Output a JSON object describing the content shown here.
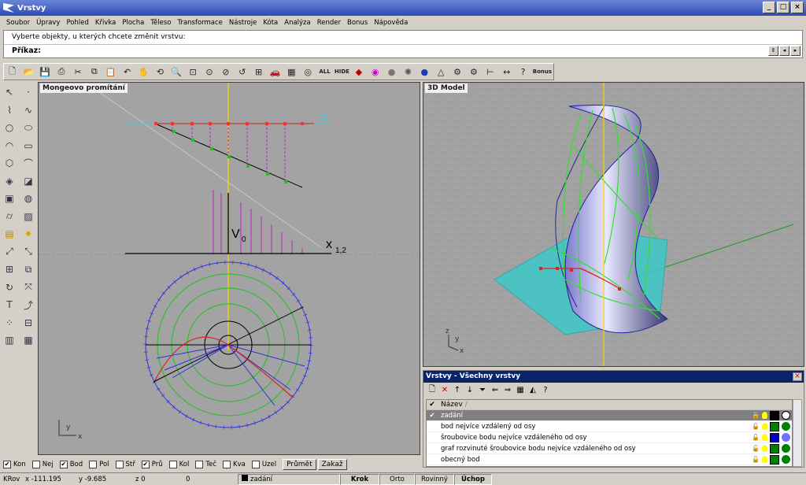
{
  "window": {
    "title": "Vrstvy"
  },
  "menu": [
    "Soubor",
    "Úpravy",
    "Pohled",
    "Křivka",
    "Plocha",
    "Těleso",
    "Transformace",
    "Nástroje",
    "Kóta",
    "Analýza",
    "Render",
    "Bonus",
    "Nápověda"
  ],
  "command": {
    "history": "Vyberte objekty, u kterých chcete změnit vrstvu:",
    "label": "Příkaz:",
    "value": ""
  },
  "toolbar": {
    "all_label": "ALL",
    "hide_label": "HIDE",
    "bonus_label": "Bonus"
  },
  "viewports": {
    "left": {
      "title": "Mongeovo promítání",
      "label_v0": "V",
      "label_v0_sub": "0",
      "label_x12": "x",
      "label_x12_sub": "1,2",
      "axis_y": "y",
      "axis_x": "x"
    },
    "right": {
      "title": "3D Model",
      "axis_z": "z",
      "axis_y": "y",
      "axis_x": "x"
    }
  },
  "layers": {
    "title": "Vrstvy - Všechny vrstvy",
    "column": "Název",
    "sort_glyph": "/",
    "rows": [
      {
        "name": "zadání",
        "color": "#000000",
        "selected": true
      },
      {
        "name": "bod nejvíce vzdálený od osy",
        "color": "#008000",
        "dot": "#008000",
        "selected": false
      },
      {
        "name": "šroubovice bodu nejvíce vzdáleného od osy",
        "color": "#0000cc",
        "dot": "#7070ff",
        "selected": false
      },
      {
        "name": "graf rozvinuté šroubovice bodu nejvíce vzdáleného od osy",
        "color": "#008000",
        "dot": "#008000",
        "selected": false
      },
      {
        "name": "obecný bod",
        "color": "#008000",
        "dot": "#008000",
        "selected": false
      }
    ]
  },
  "snaps": [
    {
      "label": "Kon",
      "checked": true
    },
    {
      "label": "Nej",
      "checked": false
    },
    {
      "label": "Bod",
      "checked": true
    },
    {
      "label": "Pol",
      "checked": false
    },
    {
      "label": "Stř",
      "checked": false
    },
    {
      "label": "Prů",
      "checked": true
    },
    {
      "label": "Kol",
      "checked": false
    },
    {
      "label": "Teč",
      "checked": false
    },
    {
      "label": "Kva",
      "checked": false
    },
    {
      "label": "Uzel",
      "checked": false
    }
  ],
  "snap_buttons": {
    "project": "Průmět",
    "disable": "Zakaž"
  },
  "status": {
    "cplane": "KRov",
    "x": "x -111.195",
    "y": "y -9.685",
    "z": "z 0",
    "extra": "0",
    "layer": "zadání",
    "grid": "Krok",
    "ortho": "Orto",
    "planar": "Rovinný",
    "osnap": "Úchop"
  },
  "colors": {
    "title_bar": "#2b4bb5",
    "viewport_bg": "#a3a3a3",
    "layer_selected": "#808080"
  }
}
